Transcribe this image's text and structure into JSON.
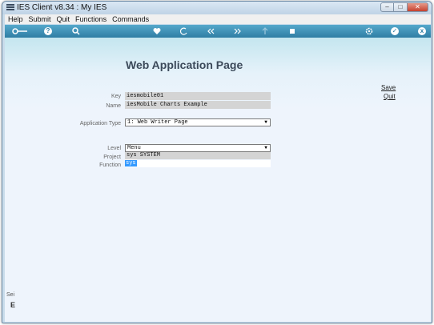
{
  "window": {
    "title": "IES Client v8.34 : My IES",
    "buttons": {
      "minimize": "–",
      "maximize": "□",
      "close": "✕"
    }
  },
  "menu": [
    "Help",
    "Submit",
    "Quit",
    "Functions",
    "Commands"
  ],
  "toolbar": {
    "icons": [
      "key-icon",
      "info-icon",
      "search-icon",
      "heart-icon",
      "refresh-icon",
      "back-icon",
      "forward-icon",
      "upload-icon",
      "stop-icon",
      "gear-icon",
      "check-icon",
      "close-icon"
    ],
    "info_glyph": "?",
    "check_glyph": "✓",
    "close_glyph": "x"
  },
  "page": {
    "title": "Web Application Page",
    "save_link": "Save",
    "quit_link": "Quit"
  },
  "form": {
    "key_label": "Key",
    "key_value": "iesmobile01",
    "name_label": "Name",
    "name_value": "iesMobile Charts Example",
    "application_type_label": "Application Type",
    "application_type_value": "1: Web Writer Page",
    "level_label": "Level",
    "level_value": "Menu",
    "project_label": "Project",
    "project_value": "sys SYSTEM",
    "function_label": "Function",
    "function_value": "sys"
  },
  "sidebar": {
    "partial_text": "Sei",
    "partial_big": "E"
  },
  "colors": {
    "toolbar": "#2f7ea4",
    "content_top": "#c4e6ef",
    "content_bg": "#eef4fc",
    "selection": "#3399ff"
  }
}
